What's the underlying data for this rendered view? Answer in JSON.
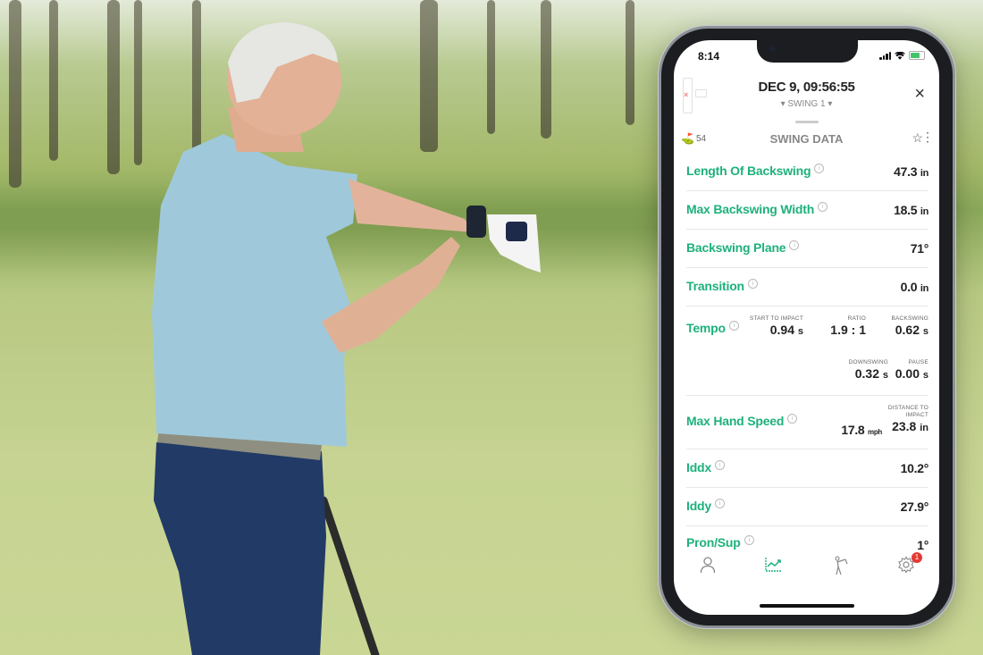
{
  "photo": {
    "description": "golfer pointing at wrist-worn swing sensor on golf course"
  },
  "status_bar": {
    "time": "8:14"
  },
  "header": {
    "title": "DEC 9, 09:56:55",
    "swing_selector": "▾ SWING 1 ▾",
    "close_icon": "×"
  },
  "device_status": {
    "error_mark": "×"
  },
  "subbar": {
    "club_count": "54",
    "section_title": "SWING DATA",
    "star_icon": "☆",
    "more_icon": "⋮"
  },
  "metrics": [
    {
      "label": "Length Of Backswing",
      "value": "47.3",
      "unit": "in"
    },
    {
      "label": "Max Backswing Width",
      "value": "18.5",
      "unit": "in"
    },
    {
      "label": "Backswing Plane",
      "value": "71°",
      "unit": ""
    },
    {
      "label": "Transition",
      "value": "0.0",
      "unit": "in"
    }
  ],
  "tempo": {
    "label": "Tempo",
    "start_to_impact": {
      "caption": "START TO IMPACT",
      "value": "0.94",
      "unit": "s"
    },
    "ratio": {
      "caption": "RATIO",
      "value": "1.9 : 1"
    },
    "backswing": {
      "caption": "BACKSWING",
      "value": "0.62",
      "unit": "s"
    },
    "downswing": {
      "caption": "DOWNSWING",
      "value": "0.32",
      "unit": "s"
    },
    "pause": {
      "caption": "PAUSE",
      "value": "0.00",
      "unit": "s"
    }
  },
  "hand_speed": {
    "label": "Max Hand Speed",
    "speed": {
      "value": "17.8",
      "unit": "mph"
    },
    "distance": {
      "caption_1": "DISTANCE TO",
      "caption_2": "IMPACT",
      "value": "23.8",
      "unit": "in"
    }
  },
  "metrics_bottom": [
    {
      "label": "Iddx",
      "value": "10.2°"
    },
    {
      "label": "Iddy",
      "value": "27.9°"
    },
    {
      "label": "Pron/Sup",
      "value": "1°"
    }
  ],
  "tabbar": {
    "settings_badge": "1"
  },
  "colors": {
    "accent": "#1db17b",
    "badge": "#e53935"
  }
}
